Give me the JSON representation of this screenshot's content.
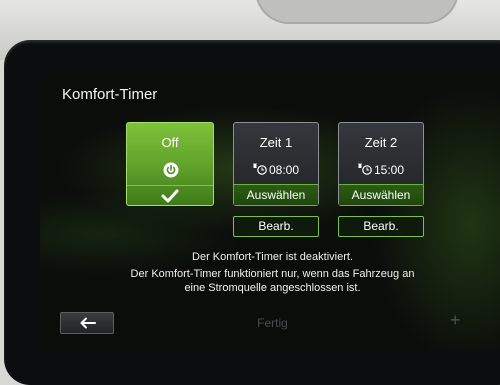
{
  "title": "Komfort-Timer",
  "off_card": {
    "label": "Off",
    "icon": "power-icon",
    "selected": true
  },
  "timers": [
    {
      "label": "Zeit 1",
      "time": "08:00",
      "icon": "plug-clock-icon",
      "select_label": "Auswählen",
      "edit_label": "Bearb."
    },
    {
      "label": "Zeit 2",
      "time": "15:00",
      "icon": "plug-clock-icon",
      "select_label": "Auswählen",
      "edit_label": "Bearb."
    }
  ],
  "messages": {
    "line1": "Der Komfort-Timer ist deaktiviert.",
    "line2": "Der Komfort-Timer funktioniert nur, wenn das Fahrzeug an",
    "line3": "eine Stromquelle angeschlossen ist."
  },
  "footer": {
    "done_label": "Fertig",
    "plus_label": "+"
  },
  "colors": {
    "accent_green": "#6fb236",
    "background": "#0b0d0b"
  }
}
